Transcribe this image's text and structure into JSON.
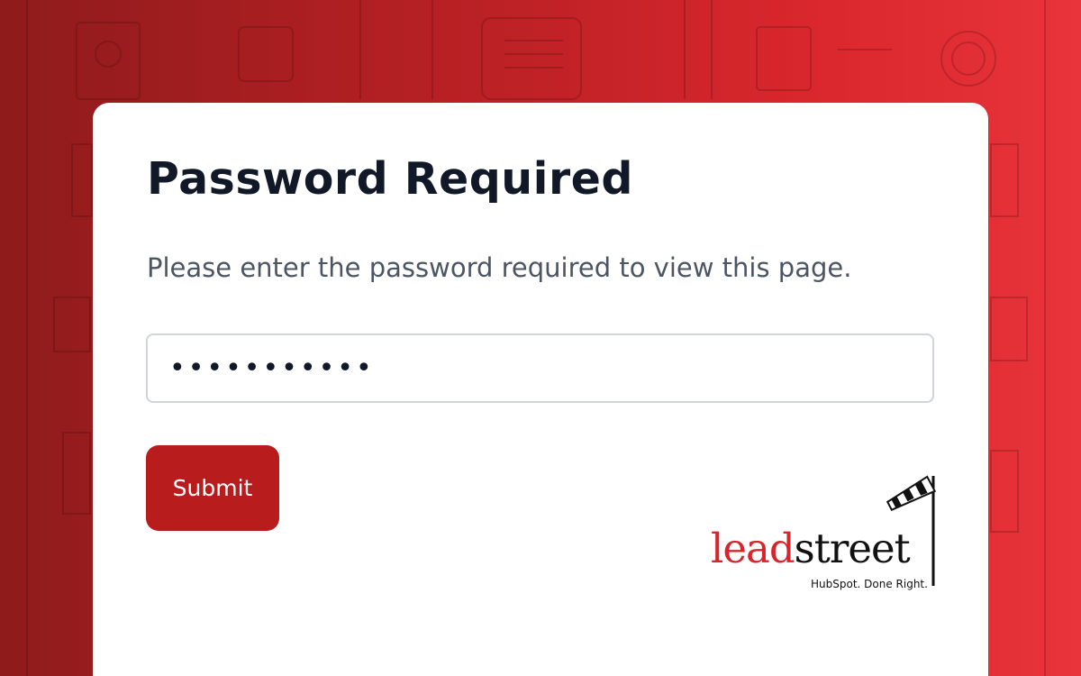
{
  "page": {
    "title": "Password Required",
    "subtitle": "Please enter the password required to view this page."
  },
  "form": {
    "password_value": "•••••••••••",
    "submit_label": "Submit"
  },
  "logo": {
    "lead": "lead",
    "street": "street",
    "tagline": "HubSpot. Done Right."
  },
  "colors": {
    "brand_red": "#b91c1c",
    "logo_red": "#d6252b",
    "heading": "#111827",
    "body_text": "#4b5563"
  },
  "icons": {
    "logo_icon": "windsock-icon"
  }
}
